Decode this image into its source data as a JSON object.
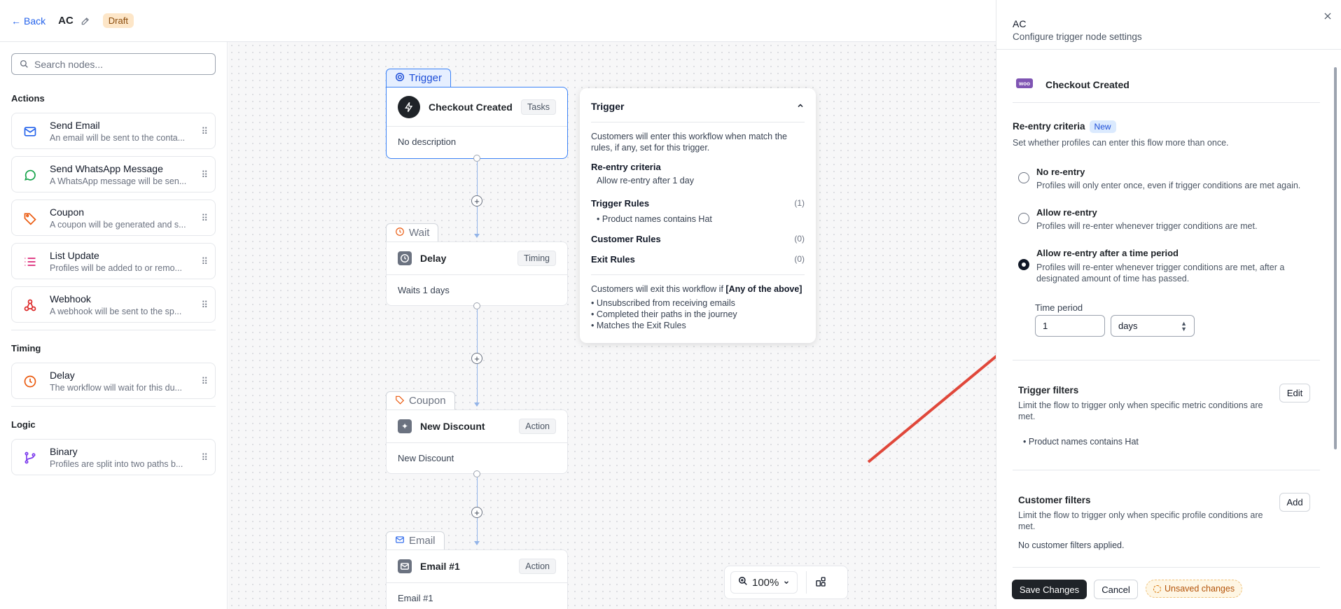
{
  "header": {
    "back_label": "Back",
    "workflow_name": "AC",
    "status_badge": "Draft"
  },
  "sidebar": {
    "search_placeholder": "Search nodes...",
    "sections": {
      "actions": {
        "title": "Actions",
        "items": [
          {
            "title": "Send Email",
            "desc": "An email will be sent to the conta...",
            "icon": "mail-icon"
          },
          {
            "title": "Send WhatsApp Message",
            "desc": "A WhatsApp message will be sen...",
            "icon": "whatsapp-icon"
          },
          {
            "title": "Coupon",
            "desc": "A coupon will be generated and s...",
            "icon": "tag-icon"
          },
          {
            "title": "List Update",
            "desc": "Profiles will be added to or remo...",
            "icon": "list-icon"
          },
          {
            "title": "Webhook",
            "desc": "A webhook will be sent to the sp...",
            "icon": "webhook-icon"
          }
        ]
      },
      "timing": {
        "title": "Timing",
        "items": [
          {
            "title": "Delay",
            "desc": "The workflow will wait for this du...",
            "icon": "clock-icon"
          }
        ]
      },
      "logic": {
        "title": "Logic",
        "items": [
          {
            "title": "Binary",
            "desc": "Profiles are split into two paths b...",
            "icon": "branch-icon"
          }
        ]
      }
    }
  },
  "canvas": {
    "nodes": [
      {
        "tab": "Trigger",
        "title": "Checkout Created",
        "pill": "Tasks",
        "body": "No description"
      },
      {
        "tab": "Wait",
        "title": "Delay",
        "pill": "Timing",
        "body": "Waits 1 days"
      },
      {
        "tab": "Coupon",
        "title": "New Discount",
        "pill": "Action",
        "body": "New Discount"
      },
      {
        "tab": "Email",
        "title": "Email #1",
        "pill": "Action",
        "body": "Email #1"
      }
    ],
    "zoom": "100%"
  },
  "popover": {
    "title": "Trigger",
    "intro": "Customers will enter this workflow when match the rules, if any, set for this trigger.",
    "reentry_label": "Re-entry criteria",
    "reentry_value": "Allow re-entry after 1 day",
    "trigger_rules_label": "Trigger Rules",
    "trigger_rules_count": "(1)",
    "trigger_rule_item": "Product names contains Hat",
    "customer_rules_label": "Customer Rules",
    "customer_rules_count": "(0)",
    "exit_rules_label": "Exit Rules",
    "exit_rules_count": "(0)",
    "exit_intro": "Customers will exit this workflow if",
    "exit_intro_bold": "[Any of the above]",
    "exit_items": [
      "Unsubscribed from receiving emails",
      "Completed their paths in the journey",
      "Matches the Exit Rules"
    ]
  },
  "panel": {
    "title": "AC",
    "subtitle": "Configure trigger node settings",
    "trigger_name": "Checkout Created",
    "woo_logo": "woo",
    "reentry": {
      "title": "Re-entry criteria",
      "badge": "New",
      "desc": "Set whether profiles can enter this flow more than once.",
      "options": [
        {
          "label": "No re-entry",
          "desc": "Profiles will only enter once, even if trigger conditions are met again.",
          "selected": false
        },
        {
          "label": "Allow re-entry",
          "desc": "Profiles will re-enter whenever trigger conditions are met.",
          "selected": false
        },
        {
          "label": "Allow re-entry after a time period",
          "desc": "Profiles will re-enter whenever trigger conditions are met, after a designated amount of time has passed.",
          "selected": true
        }
      ],
      "time_period_label": "Time period",
      "time_period_value": "1",
      "time_unit": "days"
    },
    "trigger_filters": {
      "title": "Trigger filters",
      "desc": "Limit the flow to trigger only when specific metric conditions are met.",
      "button": "Edit",
      "item": "Product names contains Hat"
    },
    "customer_filters": {
      "title": "Customer filters",
      "desc": "Limit the flow to trigger only when specific profile conditions are met.",
      "button": "Add",
      "empty": "No customer filters applied."
    },
    "footer": {
      "save": "Save Changes",
      "cancel": "Cancel",
      "unsaved": "Unsaved changes"
    }
  },
  "colors": {
    "accent": "#3b82f6",
    "annotation_arrow": "#e0473a",
    "draft_bg": "#fde6c8"
  }
}
